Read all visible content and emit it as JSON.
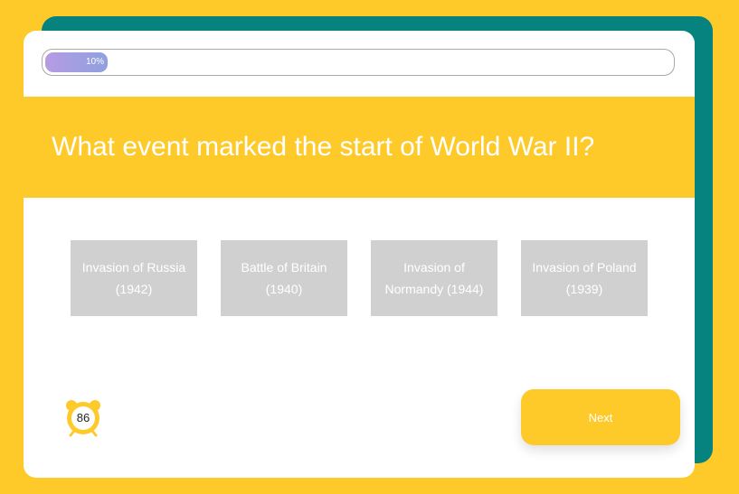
{
  "progress": {
    "label": "10%",
    "fraction": 0.1
  },
  "question": {
    "text": "What event marked the start of World War II?"
  },
  "answers": [
    {
      "label": "Invasion of Russia (1942)"
    },
    {
      "label": "Battle of Britain (1940)"
    },
    {
      "label": "Invasion of Normandy (1944)"
    },
    {
      "label": "Invasion of Poland (1939)"
    }
  ],
  "timer": {
    "value": "86",
    "icon": "alarm-clock-icon"
  },
  "controls": {
    "next_label": "Next"
  },
  "colors": {
    "accent": "#fdca2a",
    "teal": "#07837f",
    "answer_bg": "#d0d0d0",
    "progress_start": "#b79be3",
    "progress_end": "#8fa0e0"
  }
}
